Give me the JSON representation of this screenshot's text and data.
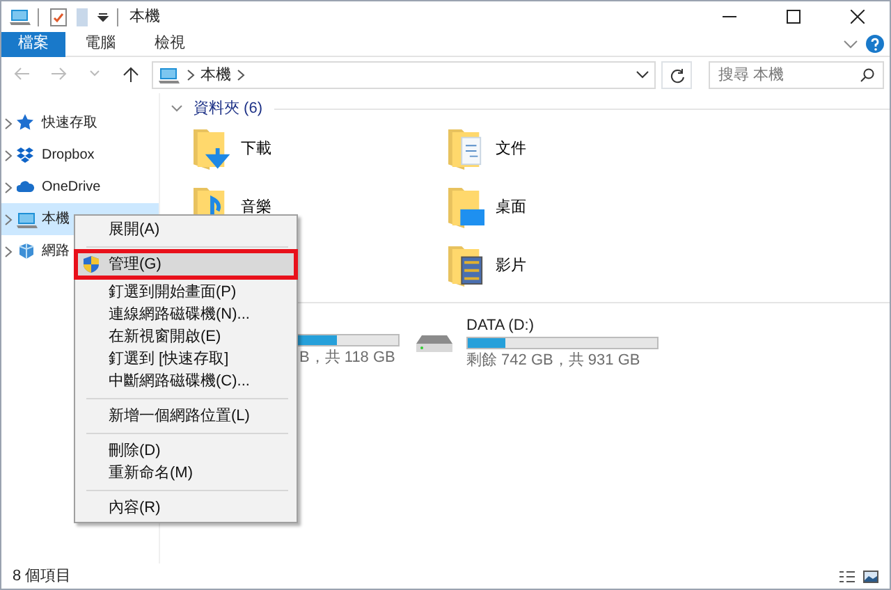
{
  "window": {
    "title": "本機"
  },
  "ribbon_tabs": [
    {
      "label": "檔案",
      "kind": "file",
      "selected": false
    },
    {
      "label": "電腦",
      "kind": "tab",
      "selected": false
    },
    {
      "label": "檢視",
      "kind": "tab",
      "selected": false
    }
  ],
  "address_bar": {
    "path": [
      "本機"
    ]
  },
  "search": {
    "placeholder": "搜尋 本機"
  },
  "sidebar": {
    "items": [
      {
        "label": "快速存取",
        "selected": false
      },
      {
        "label": "Dropbox",
        "selected": false
      },
      {
        "label": "OneDrive",
        "selected": false
      },
      {
        "label": "本機",
        "selected": true
      },
      {
        "label": "網路",
        "selected": false
      }
    ]
  },
  "folders": {
    "title": "資料夾 (6)",
    "expanded": true,
    "items": [
      {
        "label": "下載"
      },
      {
        "label": "文件"
      },
      {
        "label": "音樂"
      },
      {
        "label": "桌面"
      },
      {
        "label": "影片"
      }
    ]
  },
  "drives": [
    {
      "usage": "B，共 118 GB",
      "level": 0.68
    },
    {
      "name": "DATA (D:)",
      "usage": "剩餘 742 GB，共 931 GB",
      "level": 0.2
    }
  ],
  "context_menu": {
    "items": [
      {
        "kind": "item",
        "label": "展開(A)",
        "highlighted": false
      },
      {
        "kind": "separator"
      },
      {
        "kind": "item",
        "label": "管理(G)",
        "highlighted": true,
        "shield": true
      },
      {
        "kind": "item",
        "label": "釘選到開始畫面(P)",
        "highlighted": false
      },
      {
        "kind": "item",
        "label": "連線網路磁碟機(N)...",
        "highlighted": false
      },
      {
        "kind": "item",
        "label": "在新視窗開啟(E)",
        "highlighted": false
      },
      {
        "kind": "item",
        "label": "釘選到 [快速存取]",
        "highlighted": false
      },
      {
        "kind": "item",
        "label": "中斷網路磁碟機(C)...",
        "highlighted": false
      },
      {
        "kind": "separator"
      },
      {
        "kind": "item",
        "label": "新增一個網路位置(L)",
        "highlighted": false
      },
      {
        "kind": "separator"
      },
      {
        "kind": "item",
        "label": "刪除(D)",
        "highlighted": false
      },
      {
        "kind": "item",
        "label": "重新命名(M)",
        "highlighted": false
      },
      {
        "kind": "separator"
      },
      {
        "kind": "item",
        "label": "內容(R)",
        "highlighted": false
      }
    ]
  },
  "status_bar": {
    "text": "8 個項目"
  }
}
